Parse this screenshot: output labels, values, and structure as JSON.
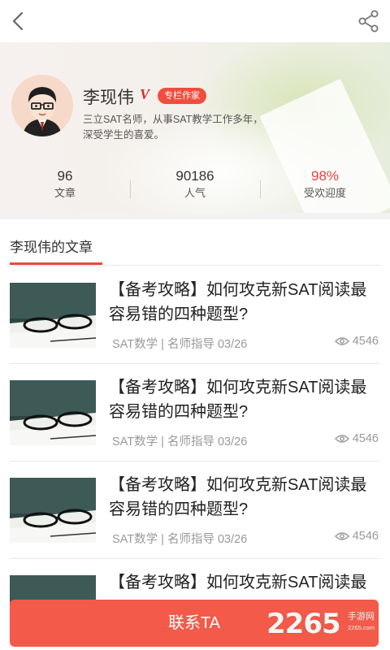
{
  "header": {
    "back_icon": "back-arrow-icon",
    "share_icon": "share-icon"
  },
  "profile": {
    "name": "李现伟",
    "v_badge": "V",
    "tag": "专栏作家",
    "bio_line1": "三立SAT名师，从事SAT教学工作多年，",
    "bio_line2": "深受学生的喜爱。",
    "avatar_icon": "teacher-avatar-icon"
  },
  "stats": [
    {
      "value": "96",
      "label": "文章"
    },
    {
      "value": "90186",
      "label": "人气"
    },
    {
      "value": "98%",
      "label": "受欢迎度"
    }
  ],
  "section": {
    "title": "李现伟的文章"
  },
  "articles": [
    {
      "title": "【备考攻略】如何攻克新SAT阅读最容易错的四种题型?",
      "meta": "SAT数学 | 名师指导   03/26",
      "views": "4546"
    },
    {
      "title": "【备考攻略】如何攻克新SAT阅读最容易错的四种题型?",
      "meta": "SAT数学 | 名师指导   03/26",
      "views": "4546"
    },
    {
      "title": "【备考攻略】如何攻克新SAT阅读最容易错的四种题型?",
      "meta": "SAT数学 | 名师指导   03/26",
      "views": "4546"
    },
    {
      "title": "【备考攻略】如何攻克新SAT阅读最",
      "meta": "",
      "views": ""
    }
  ],
  "contact_button": "联系TA",
  "watermark": {
    "big": "2265",
    "small": "手游网",
    "url": "2265.com"
  },
  "colors": {
    "accent": "#f35a4a",
    "tag": "#f04d3e",
    "popularity": "#e9443a"
  }
}
